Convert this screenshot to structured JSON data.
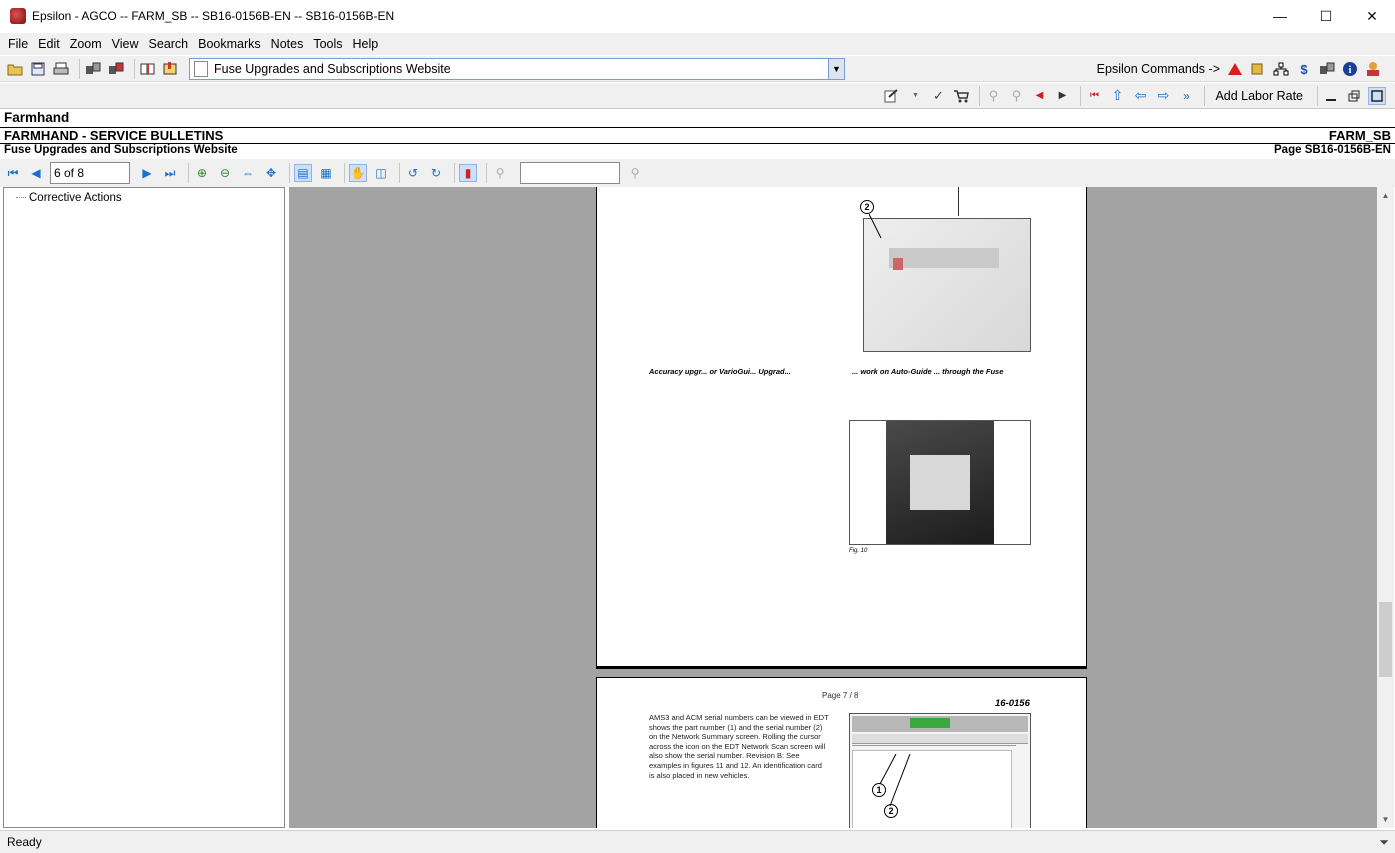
{
  "window": {
    "title": "Epsilon - AGCO -- FARM_SB -- SB16-0156B-EN -- SB16-0156B-EN",
    "minimize_glyph": "—",
    "maximize_glyph": "☐",
    "close_glyph": "✕"
  },
  "menu": {
    "file": "File",
    "edit": "Edit",
    "zoom": "Zoom",
    "view": "View",
    "search": "Search",
    "bookmarks": "Bookmarks",
    "notes": "Notes",
    "tools": "Tools",
    "help": "Help"
  },
  "toolbar": {
    "document_selector_value": "Fuse Upgrades and Subscriptions Website",
    "commands_label": "Epsilon Commands ->",
    "add_labor_rate": "Add Labor Rate"
  },
  "header": {
    "brand": "Farmhand",
    "section": "FARMHAND - SERVICE BULLETINS",
    "section_code": "FARM_SB",
    "doc_title": "Fuse Upgrades and Subscriptions Website",
    "doc_page": "Page SB16-0156B-EN"
  },
  "navigation": {
    "page_indicator": "6 of 8",
    "search_value": ""
  },
  "tree": {
    "items": [
      "Corrective Actions"
    ]
  },
  "document": {
    "page_a": {
      "callout_2": "2",
      "paragraph_left": "Accuracy upgr... or VarioGui... Upgrad...",
      "paragraph_right": "... work on Auto-Guide ... through the Fuse",
      "fig_caption": "Fig. 10"
    },
    "page_b": {
      "page_label": "Page 7 / 8",
      "doc_number": "16-0156",
      "body": "AMS3 and ACM serial numbers can be viewed in EDT shows the part number (1) and the serial number (2) on the Network Summary screen. Rolling the cursor across the icon on the EDT Network Scan screen will also show the serial number. Revision B: See examples in figures 11 and 12. An identification card is also placed in new vehicles.",
      "callout_1": "1",
      "callout_2": "2"
    }
  },
  "status": {
    "text": "Ready"
  }
}
